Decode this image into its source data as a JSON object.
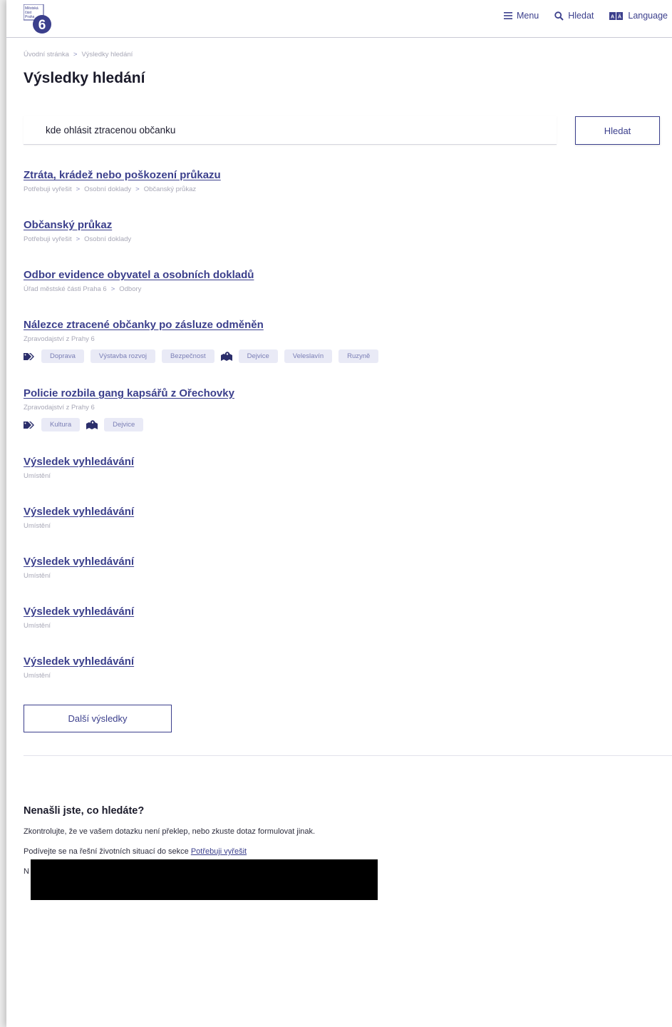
{
  "header": {
    "logo": {
      "line1": "Městská",
      "line2": "část",
      "line3": "Praha",
      "number": "6",
      "brand_color": "#3b3f8c"
    },
    "nav": [
      {
        "icon": "menu-icon",
        "label": "Menu"
      },
      {
        "icon": "search-icon",
        "label": "Hledat"
      },
      {
        "icon": "language-icon",
        "label": "Language"
      }
    ]
  },
  "breadcrumb": {
    "items": [
      "Úvodní stránka",
      "Výsledky hledání"
    ],
    "separator": ">"
  },
  "page_title": "Výsledky hledání",
  "search": {
    "value": "kde ohlásit ztracenou občanku",
    "button_label": "Hledat"
  },
  "results": [
    {
      "title": "Ztráta, krádež nebo poškození průkazu",
      "path": [
        "Potřebuji vyřešit",
        "Osobní doklady",
        "Občanský průkaz"
      ]
    },
    {
      "title": "Občanský průkaz",
      "path": [
        "Potřebuji vyřešit",
        "Osobní doklady"
      ]
    },
    {
      "title": "Odbor evidence obyvatel a osobních dokladů",
      "path": [
        "Úřad městské části Praha 6",
        "Odbory"
      ]
    },
    {
      "title": "Nálezce ztracené občanky po zásluze odměněn",
      "path": [
        "Zpravodajství z Prahy 6"
      ],
      "topic_tags": [
        "Doprava",
        "Výstavba rozvoj",
        "Bezpečnost"
      ],
      "location_tags": [
        "Dejvice",
        "Veleslavín",
        "Ruzyně"
      ]
    },
    {
      "title": "Policie rozbila gang kapsářů z Ořechovky",
      "path": [
        "Zpravodajství z Prahy 6"
      ],
      "topic_tags": [
        "Kultura"
      ],
      "location_tags": [
        "Dejvice"
      ]
    },
    {
      "title": "Výsledek vyhledávání",
      "path": [
        "Umístění"
      ]
    },
    {
      "title": "Výsledek vyhledávání",
      "path": [
        "Umístění"
      ]
    },
    {
      "title": "Výsledek vyhledávání",
      "path": [
        "Umístění"
      ]
    },
    {
      "title": "Výsledek vyhledávání",
      "path": [
        "Umístění"
      ]
    },
    {
      "title": "Výsledek vyhledávání",
      "path": [
        "Umístění"
      ]
    }
  ],
  "more_button": "Další výsledky",
  "help": {
    "title": "Nenašli jste, co hledáte?",
    "line1": "Zkontrolujte, že ve vašem dotazku není překlep, nebo zkuste dotaz formulovat jinak.",
    "line2_prefix": "Podívejte se na řešní životních situací do sekce",
    "line2_link": "Potřebuji vyřešit",
    "line3_visible": "N"
  }
}
